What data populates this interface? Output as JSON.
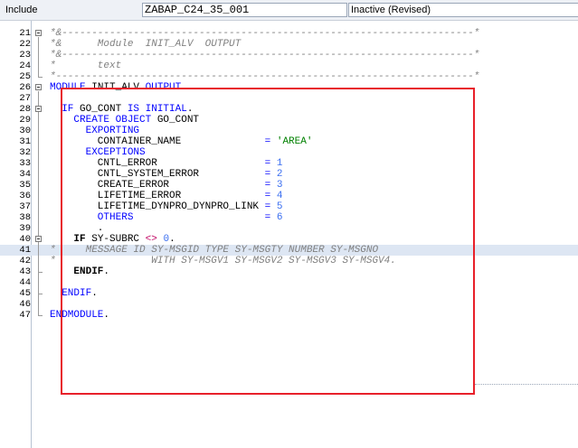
{
  "header": {
    "label": "Include",
    "program_name": "ZABAP_C24_35_001",
    "status": "Inactive (Revised)"
  },
  "lines": [
    {
      "n": "21",
      "segs": [
        {
          "t": "*&---------------------------------------------------------------------*",
          "c": "cm"
        }
      ]
    },
    {
      "n": "22",
      "segs": [
        {
          "t": "*&      Module  INIT_ALV  OUTPUT",
          "c": "cm"
        }
      ]
    },
    {
      "n": "23",
      "segs": [
        {
          "t": "*&---------------------------------------------------------------------*",
          "c": "cm"
        }
      ]
    },
    {
      "n": "24",
      "segs": [
        {
          "t": "*       text",
          "c": "cm"
        }
      ]
    },
    {
      "n": "25",
      "segs": [
        {
          "t": "*----------------------------------------------------------------------*",
          "c": "cm"
        }
      ]
    },
    {
      "n": "26",
      "segs": [
        {
          "t": "MODULE ",
          "c": "kw"
        },
        {
          "t": "INIT_ALV ",
          "c": "ident"
        },
        {
          "t": "OUTPUT",
          "c": "kw"
        },
        {
          "t": ".",
          "c": "ident"
        }
      ]
    },
    {
      "n": "27",
      "segs": []
    },
    {
      "n": "28",
      "segs": [
        {
          "t": "  IF ",
          "c": "kw"
        },
        {
          "t": "GO_CONT ",
          "c": "ident"
        },
        {
          "t": "IS INITIAL",
          "c": "kw"
        },
        {
          "t": ".",
          "c": "ident"
        }
      ]
    },
    {
      "n": "29",
      "segs": [
        {
          "t": "    CREATE OBJECT ",
          "c": "kw"
        },
        {
          "t": "GO_CONT",
          "c": "ident"
        }
      ]
    },
    {
      "n": "30",
      "segs": [
        {
          "t": "      EXPORTING",
          "c": "kw"
        }
      ]
    },
    {
      "n": "31",
      "segs": [
        {
          "t": "        CONTAINER_NAME              ",
          "c": "ident"
        },
        {
          "t": "= ",
          "c": "kw"
        },
        {
          "t": "'AREA'",
          "c": "str"
        }
      ]
    },
    {
      "n": "32",
      "segs": [
        {
          "t": "      EXCEPTIONS",
          "c": "kw"
        }
      ]
    },
    {
      "n": "33",
      "segs": [
        {
          "t": "        CNTL_ERROR                  ",
          "c": "ident"
        },
        {
          "t": "= ",
          "c": "kw"
        },
        {
          "t": "1",
          "c": "num"
        }
      ]
    },
    {
      "n": "34",
      "segs": [
        {
          "t": "        CNTL_SYSTEM_ERROR           ",
          "c": "ident"
        },
        {
          "t": "= ",
          "c": "kw"
        },
        {
          "t": "2",
          "c": "num"
        }
      ]
    },
    {
      "n": "35",
      "segs": [
        {
          "t": "        CREATE_ERROR                ",
          "c": "ident"
        },
        {
          "t": "= ",
          "c": "kw"
        },
        {
          "t": "3",
          "c": "num"
        }
      ]
    },
    {
      "n": "36",
      "segs": [
        {
          "t": "        LIFETIME_ERROR              ",
          "c": "ident"
        },
        {
          "t": "= ",
          "c": "kw"
        },
        {
          "t": "4",
          "c": "num"
        }
      ]
    },
    {
      "n": "37",
      "segs": [
        {
          "t": "        LIFETIME_DYNPRO_DYNPRO_LINK ",
          "c": "ident"
        },
        {
          "t": "= ",
          "c": "kw"
        },
        {
          "t": "5",
          "c": "num"
        }
      ]
    },
    {
      "n": "38",
      "segs": [
        {
          "t": "        OTHERS                      ",
          "c": "kw"
        },
        {
          "t": "= ",
          "c": "kw"
        },
        {
          "t": "6",
          "c": "num"
        }
      ]
    },
    {
      "n": "39",
      "segs": [
        {
          "t": "        .",
          "c": "ident"
        }
      ]
    },
    {
      "n": "40",
      "segs": [
        {
          "t": "    IF ",
          "c": "kwb"
        },
        {
          "t": "SY-SUBRC ",
          "c": "ident"
        },
        {
          "t": "<> ",
          "c": "op"
        },
        {
          "t": "0",
          "c": "num"
        },
        {
          "t": ".",
          "c": "ident"
        }
      ]
    },
    {
      "n": "41",
      "hl": true,
      "segs": [
        {
          "t": "*     MESSAGE ID SY-MSGID TYPE SY-MSGTY NUMBER SY-MSGNO",
          "c": "cm"
        }
      ]
    },
    {
      "n": "42",
      "segs": [
        {
          "t": "*                WITH SY-MSGV1 SY-MSGV2 SY-MSGV3 SY-MSGV4.",
          "c": "cm"
        }
      ]
    },
    {
      "n": "43",
      "segs": [
        {
          "t": "    ENDIF",
          "c": "kwb"
        },
        {
          "t": ".",
          "c": "ident"
        }
      ]
    },
    {
      "n": "44",
      "segs": []
    },
    {
      "n": "45",
      "segs": [
        {
          "t": "  ENDIF",
          "c": "kw"
        },
        {
          "t": ".",
          "c": "ident"
        }
      ]
    },
    {
      "n": "46",
      "segs": []
    },
    {
      "n": "47",
      "segs": [
        {
          "t": "ENDMODULE",
          "c": "kw"
        },
        {
          "t": ".",
          "c": "ident"
        }
      ]
    }
  ],
  "colors": {
    "keyword": "#0000ff",
    "comment": "#808080",
    "string": "#008000",
    "number": "#3a6ef0",
    "highlight_row": "#dde6f3",
    "annotation_box": "#e8202a"
  }
}
